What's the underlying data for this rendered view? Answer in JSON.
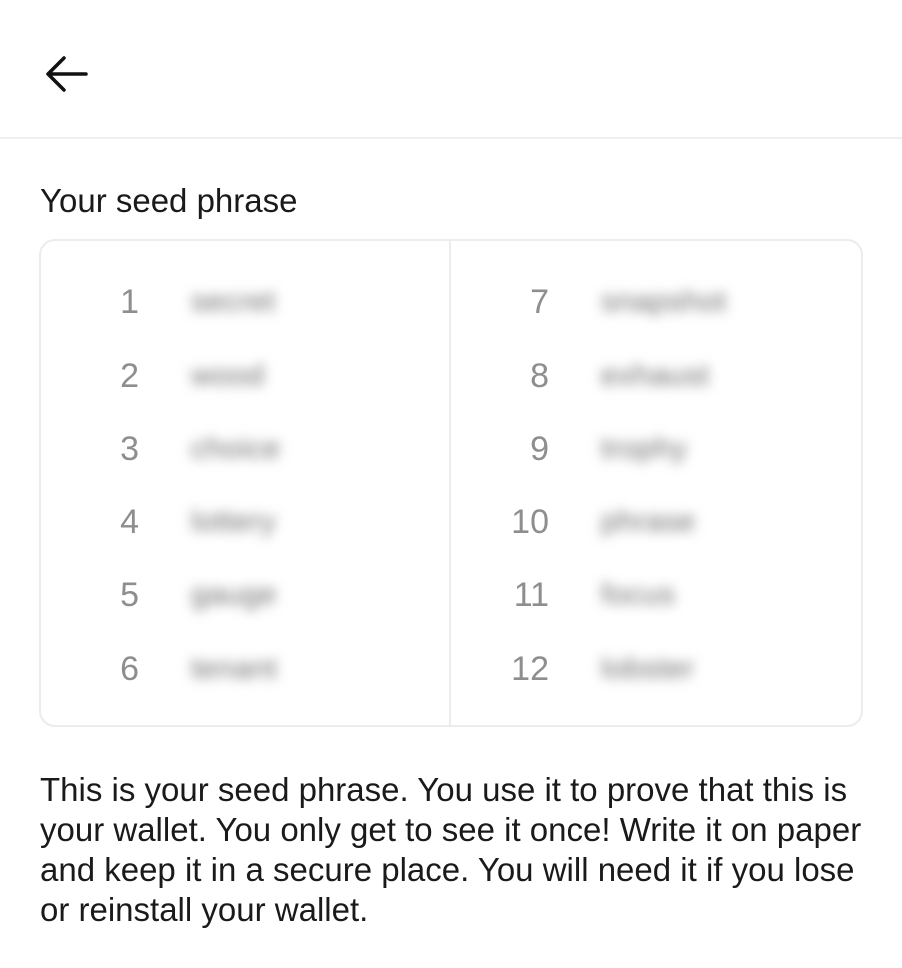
{
  "header": {
    "back_icon": "arrow-left-icon"
  },
  "section_title": "Your seed phrase",
  "seed_words": [
    {
      "number": "1",
      "word": "secret"
    },
    {
      "number": "2",
      "word": "wood"
    },
    {
      "number": "3",
      "word": "choice"
    },
    {
      "number": "4",
      "word": "lottery"
    },
    {
      "number": "5",
      "word": "gauge"
    },
    {
      "number": "6",
      "word": "tenant"
    },
    {
      "number": "7",
      "word": "snapshot"
    },
    {
      "number": "8",
      "word": "exhaust"
    },
    {
      "number": "9",
      "word": "trophy"
    },
    {
      "number": "10",
      "word": "phrase"
    },
    {
      "number": "11",
      "word": "focus"
    },
    {
      "number": "12",
      "word": "lobster"
    }
  ],
  "description": "This is your seed phrase. You use it to prove that this is your wallet. You only get to see it once! Write it on paper and keep it in a secure place. You will need it if you lose or reinstall your wallet.",
  "colors": {
    "text": "#1a1a1a",
    "number": "#8e8e8e",
    "border": "#ececec"
  }
}
